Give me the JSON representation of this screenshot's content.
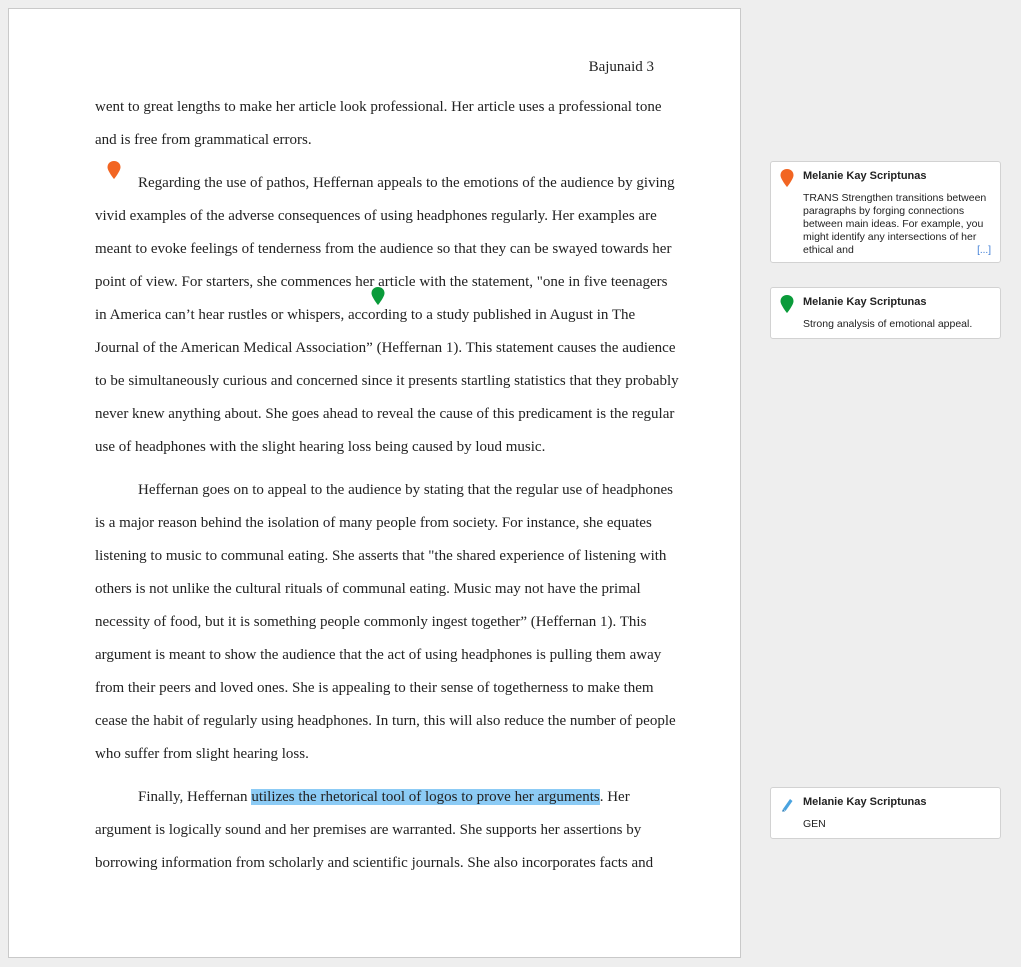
{
  "document": {
    "header": "Bajunaid 3",
    "paragraph1": {
      "lines": [
        "went to great lengths to make her article look professional. Her article uses a professional tone",
        "and is free from grammatical errors."
      ]
    },
    "paragraph2": {
      "lines": [
        "Regarding the use of pathos, Heffernan appeals to the emotions of the audience by giving",
        "vivid examples of the adverse consequences of using headphones regularly. Her examples are",
        "meant to evoke feelings of tenderness from the audience so that they can be swayed towards her",
        "point of view. For starters, she commences her article with the statement, \"one in five teenagers",
        "in America can’t hear rustles or whispers, according to a study published in August in The",
        "Journal of the American Medical Association” (Heffernan 1). This statement causes the audience",
        "to be simultaneously curious and concerned since it presents startling statistics that they probably",
        "never knew anything about. She goes ahead to reveal the cause of this predicament is the regular",
        "use of headphones with the slight hearing loss being caused by loud music."
      ]
    },
    "paragraph3": {
      "lines": [
        "Heffernan goes on to appeal to the audience by stating that the regular use of headphones",
        "is a major reason behind the isolation of many people from society. For instance, she equates",
        "listening to music to communal eating. She asserts that \"the shared experience of listening with",
        "others is not unlike the cultural rituals of communal eating. Music may not have the primal",
        "necessity of food, but it is something people commonly ingest together” (Heffernan 1). This",
        "argument is meant to show the audience that the act of using headphones is pulling them away",
        "from their peers and loved ones. She is appealing to their sense of togetherness to make them",
        "cease the habit of regularly using headphones. In turn, this will also reduce the number of people",
        "who suffer from slight hearing loss."
      ]
    },
    "paragraph4": {
      "first_line_before": "Finally, Heffernan ",
      "first_line_highlight": "utilizes the rhetorical tool of logos to prove her arguments",
      "first_line_after": ". Her",
      "lines": [
        "argument is logically sound and her premises are warranted. She supports her assertions by",
        "borrowing information from scholarly and scientific journals. She also incorporates facts and"
      ]
    }
  },
  "comments": [
    {
      "author": "Melanie Kay Scriptunas",
      "text": "TRANS Strengthen transitions between paragraphs by forging connections between main ideas. For example, you might identify any intersections of her ethical and",
      "more": "[...]",
      "icon": "pin-icon",
      "color": "#f26522"
    },
    {
      "author": "Melanie Kay Scriptunas",
      "text": "Strong analysis of emotional appeal.",
      "icon": "pin-icon",
      "color": "#0a9b3a"
    },
    {
      "author": "Melanie Kay Scriptunas",
      "text": "GEN",
      "icon": "highlighter-icon",
      "color": "#4aa3df"
    }
  ],
  "highlight_color": "#8ccbf5"
}
